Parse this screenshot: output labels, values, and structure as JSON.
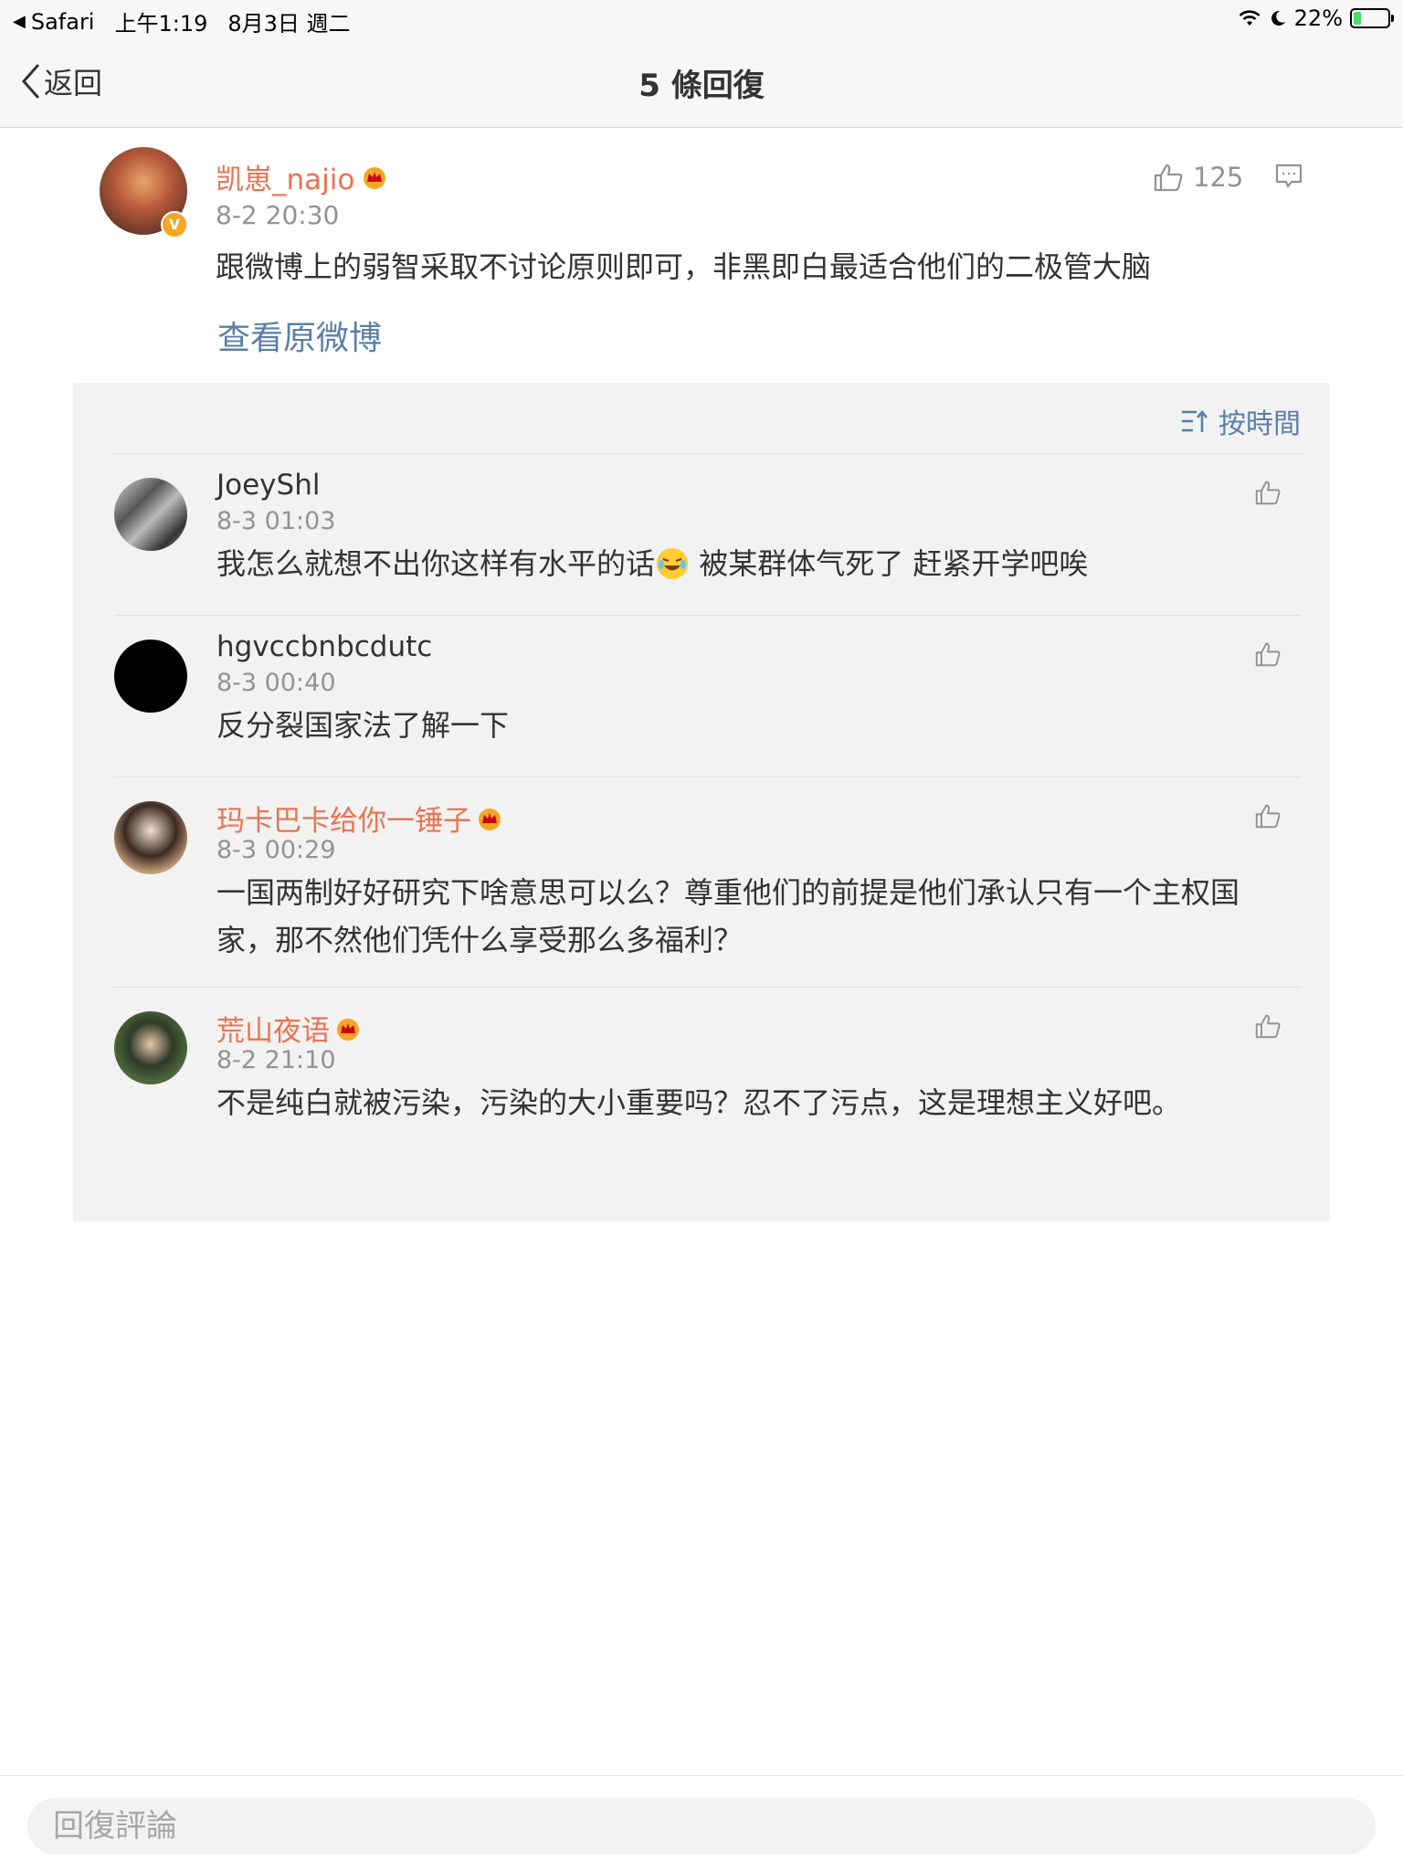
{
  "status_bar": {
    "app": "Safari",
    "time": "上午1:19",
    "date": "8月3日 週二",
    "battery": "22%",
    "battery_level": 0.22
  },
  "nav": {
    "back_label": "返回",
    "title": "5 條回復"
  },
  "main_comment": {
    "author": "凯崽_najio",
    "time": "8-2 20:30",
    "text": "跟微博上的弱智采取不讨论原则即可，非黑即白最适合他们的二极管大脑",
    "likes": "125",
    "view_original": "查看原微博"
  },
  "sort_label": "按時間",
  "replies": [
    {
      "author": "JoeyShl",
      "time": "8-3 01:03",
      "text_before": "我怎么就想不出你这样有水平的话",
      "text_after": " 被某群体气死了 赶紧开学吧唉"
    },
    {
      "author": "hgvccbnbcdutc",
      "time": "8-3 00:40",
      "text": "反分裂国家法了解一下"
    },
    {
      "author": "玛卡巴卡给你一锤子",
      "time": "8-3 00:29",
      "text": "一国两制好好研究下啥意思可以么？尊重他们的前提是他们承认只有一个主权国家，那不然他们凭什么享受那么多福利？"
    },
    {
      "author": "荒山夜语",
      "time": "8-2 21:10",
      "text": "不是纯白就被污染，污染的大小重要吗？忍不了污点，这是理想主义好吧。"
    }
  ],
  "bottom": {
    "placeholder": "回復評論"
  },
  "colors": {
    "accent_link": "#5b7fa6",
    "vip_name": "#eb7350",
    "secondary_text": "#939393"
  }
}
